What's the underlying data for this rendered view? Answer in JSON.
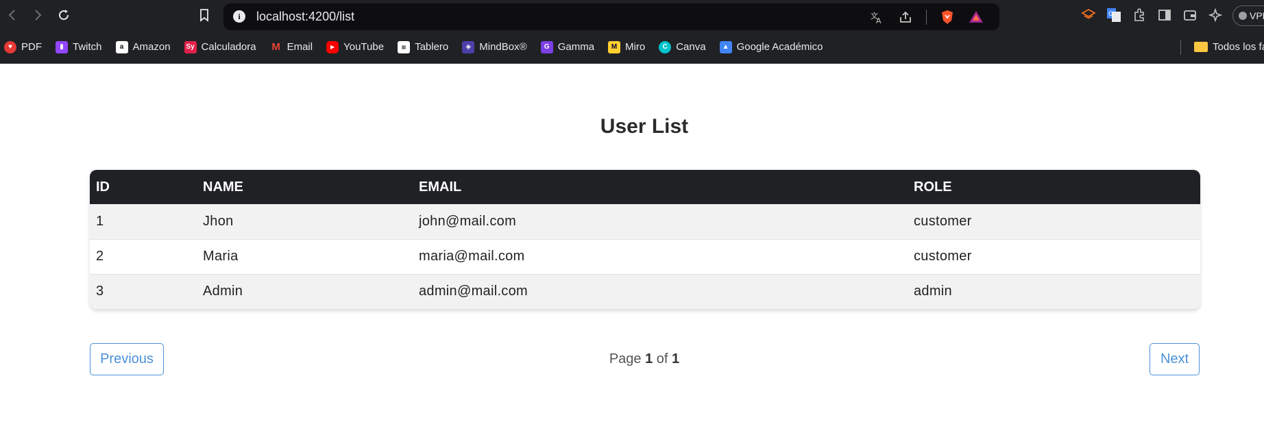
{
  "browser": {
    "url": "localhost:4200/list",
    "vpn_label": "VPN",
    "bookmarks": [
      {
        "label": "PDF",
        "icon": "pdf-icon",
        "color": "#e53935"
      },
      {
        "label": "Twitch",
        "icon": "twitch-icon",
        "color": "#9146ff"
      },
      {
        "label": "Amazon",
        "icon": "amazon-icon",
        "color": "#ffffff"
      },
      {
        "label": "Calculadora",
        "icon": "calculator-icon",
        "color": "#e0204a"
      },
      {
        "label": "Email",
        "icon": "gmail-icon",
        "color": "#ea4335"
      },
      {
        "label": "YouTube",
        "icon": "youtube-icon",
        "color": "#ff0000"
      },
      {
        "label": "Tablero",
        "icon": "board-icon",
        "color": "#ffffff"
      },
      {
        "label": "MindBox®",
        "icon": "mindbox-icon",
        "color": "#4b3fa8"
      },
      {
        "label": "Gamma",
        "icon": "gamma-icon",
        "color": "#7b3fe4"
      },
      {
        "label": "Miro",
        "icon": "miro-icon",
        "color": "#ffd02f"
      },
      {
        "label": "Canva",
        "icon": "canva-icon",
        "color": "#00c4cc"
      },
      {
        "label": "Google Académico",
        "icon": "scholar-icon",
        "color": "#4285f4"
      }
    ],
    "folder_label": "Todos los fa"
  },
  "page": {
    "title": "User List",
    "columns": [
      "ID",
      "NAME",
      "EMAIL",
      "ROLE"
    ],
    "rows": [
      {
        "id": "1",
        "name": "Jhon",
        "email": "john@mail.com",
        "role": "customer"
      },
      {
        "id": "2",
        "name": "Maria",
        "email": "maria@mail.com",
        "role": "customer"
      },
      {
        "id": "3",
        "name": "Admin",
        "email": "admin@mail.com",
        "role": "admin"
      }
    ],
    "pagination": {
      "previous_label": "Previous",
      "next_label": "Next",
      "page_word": "Page",
      "of_word": "of",
      "current_page": "1",
      "total_pages": "1"
    }
  },
  "colors": {
    "accent": "#4a90d9",
    "table_header": "#1f2125",
    "chrome": "#202124"
  }
}
